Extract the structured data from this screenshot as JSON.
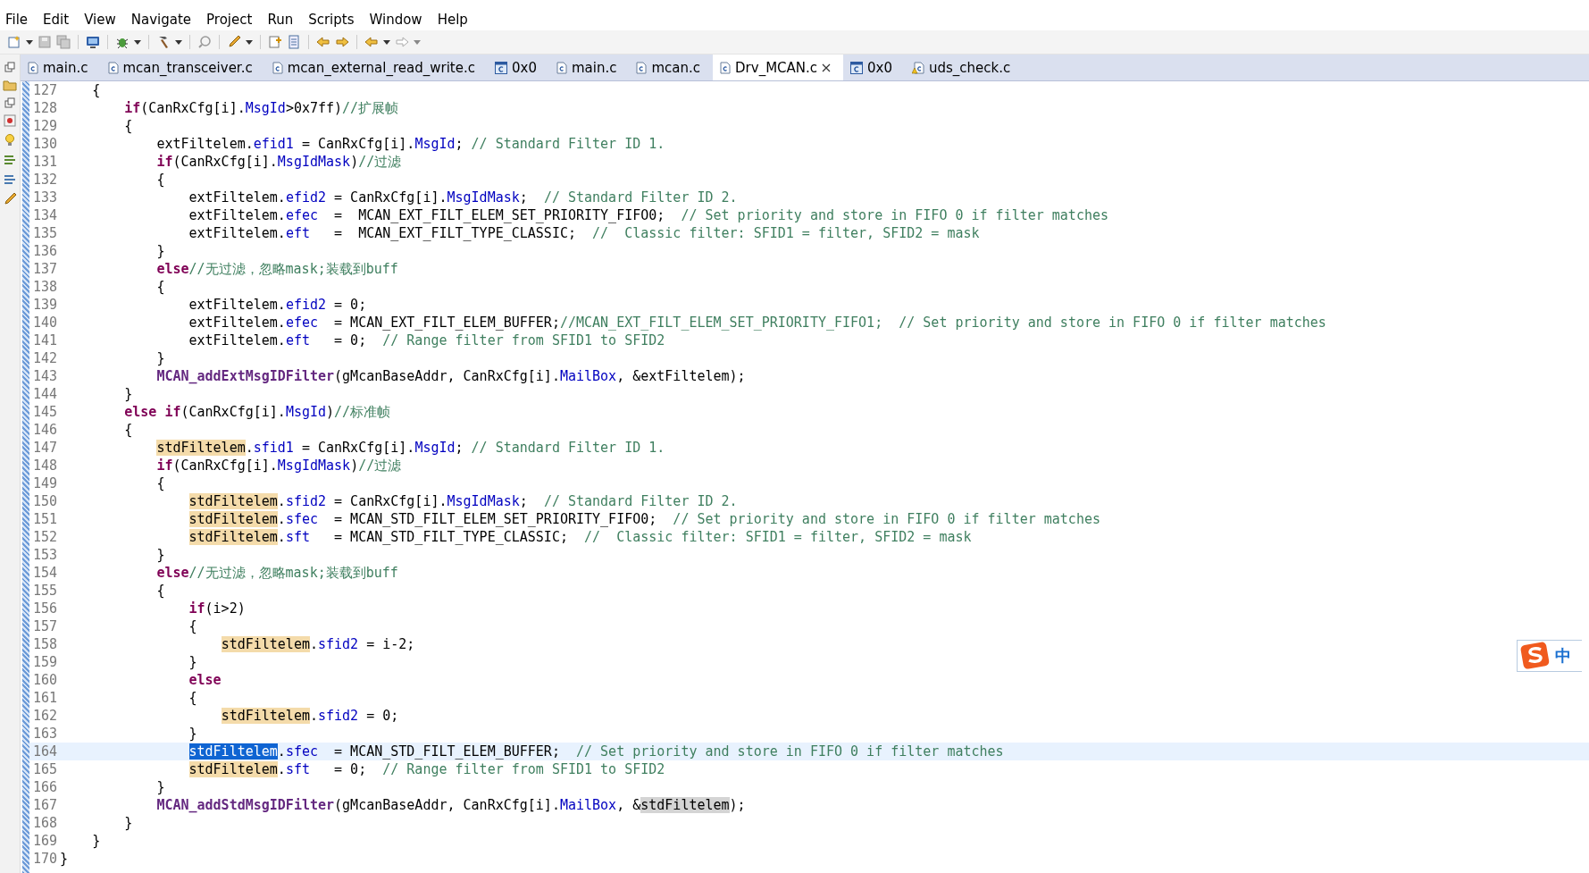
{
  "menu": [
    "File",
    "Edit",
    "View",
    "Navigate",
    "Project",
    "Run",
    "Scripts",
    "Window",
    "Help"
  ],
  "tabs": [
    {
      "label": "main.c",
      "kind": "source",
      "selected": false
    },
    {
      "label": "mcan_transceiver.c",
      "kind": "source",
      "selected": false
    },
    {
      "label": "mcan_external_read_write.c",
      "kind": "source",
      "selected": false
    },
    {
      "label": "0x0",
      "kind": "disassembly",
      "selected": false
    },
    {
      "label": "main.c",
      "kind": "source",
      "selected": false
    },
    {
      "label": "mcan.c",
      "kind": "source",
      "selected": false
    },
    {
      "label": "Drv_MCAN.c",
      "kind": "source",
      "selected": true
    },
    {
      "label": "0x0",
      "kind": "disassembly",
      "selected": false
    },
    {
      "label": "uds_check.c",
      "kind": "source-warning",
      "selected": false
    }
  ],
  "lines": [
    {
      "number": "127",
      "current": false,
      "tokens": [
        {
          "kind": "plain",
          "text": "    {"
        }
      ]
    },
    {
      "number": "128",
      "current": false,
      "tokens": [
        {
          "kind": "keyword",
          "text": "        if"
        },
        {
          "kind": "plain",
          "text": "(CanRxCfg[i]."
        },
        {
          "kind": "field",
          "text": "MsgId"
        },
        {
          "kind": "plain",
          "text": ">0x7ff)"
        },
        {
          "kind": "comment",
          "text": "//扩展帧"
        }
      ]
    },
    {
      "number": "129",
      "current": false,
      "tokens": [
        {
          "kind": "plain",
          "text": "        {"
        }
      ]
    },
    {
      "number": "130",
      "current": false,
      "tokens": [
        {
          "kind": "plain",
          "text": "            extFiltelem."
        },
        {
          "kind": "field",
          "text": "efid1"
        },
        {
          "kind": "plain",
          "text": " = CanRxCfg[i]."
        },
        {
          "kind": "field",
          "text": "MsgId"
        },
        {
          "kind": "plain",
          "text": "; "
        },
        {
          "kind": "comment",
          "text": "// Standard Filter ID 1."
        }
      ]
    },
    {
      "number": "131",
      "current": false,
      "tokens": [
        {
          "kind": "keyword",
          "text": "            if"
        },
        {
          "kind": "plain",
          "text": "(CanRxCfg[i]."
        },
        {
          "kind": "field",
          "text": "MsgIdMask"
        },
        {
          "kind": "plain",
          "text": ")"
        },
        {
          "kind": "comment",
          "text": "//过滤"
        }
      ]
    },
    {
      "number": "132",
      "current": false,
      "tokens": [
        {
          "kind": "plain",
          "text": "            {"
        }
      ]
    },
    {
      "number": "133",
      "current": false,
      "tokens": [
        {
          "kind": "plain",
          "text": "                extFiltelem."
        },
        {
          "kind": "field",
          "text": "efid2"
        },
        {
          "kind": "plain",
          "text": " = CanRxCfg[i]."
        },
        {
          "kind": "field",
          "text": "MsgIdMask"
        },
        {
          "kind": "plain",
          "text": ";  "
        },
        {
          "kind": "comment",
          "text": "// Standard Filter ID 2."
        }
      ]
    },
    {
      "number": "134",
      "current": false,
      "tokens": [
        {
          "kind": "plain",
          "text": "                extFiltelem."
        },
        {
          "kind": "field",
          "text": "efec"
        },
        {
          "kind": "plain",
          "text": "  =  MCAN_EXT_FILT_ELEM_SET_PRIORITY_FIFO0;  "
        },
        {
          "kind": "comment",
          "text": "// Set priority and store in FIFO 0 if filter matches"
        }
      ]
    },
    {
      "number": "135",
      "current": false,
      "tokens": [
        {
          "kind": "plain",
          "text": "                extFiltelem."
        },
        {
          "kind": "field",
          "text": "eft"
        },
        {
          "kind": "plain",
          "text": "   =  MCAN_EXT_FILT_TYPE_CLASSIC;  "
        },
        {
          "kind": "comment",
          "text": "//  Classic filter: SFID1 = filter, SFID2 = mask"
        }
      ]
    },
    {
      "number": "136",
      "current": false,
      "tokens": [
        {
          "kind": "plain",
          "text": "            }"
        }
      ]
    },
    {
      "number": "137",
      "current": false,
      "tokens": [
        {
          "kind": "keyword",
          "text": "            else"
        },
        {
          "kind": "comment",
          "text": "//无过滤，忽略mask;装载到buff"
        }
      ]
    },
    {
      "number": "138",
      "current": false,
      "tokens": [
        {
          "kind": "plain",
          "text": "            {"
        }
      ]
    },
    {
      "number": "139",
      "current": false,
      "tokens": [
        {
          "kind": "plain",
          "text": "                extFiltelem."
        },
        {
          "kind": "field",
          "text": "efid2"
        },
        {
          "kind": "plain",
          "text": " = 0;"
        }
      ]
    },
    {
      "number": "140",
      "current": false,
      "tokens": [
        {
          "kind": "plain",
          "text": "                extFiltelem."
        },
        {
          "kind": "field",
          "text": "efec"
        },
        {
          "kind": "plain",
          "text": "  = MCAN_EXT_FILT_ELEM_BUFFER;"
        },
        {
          "kind": "comment",
          "text": "//MCAN_EXT_FILT_ELEM_SET_PRIORITY_FIFO1;  // Set priority and store in FIFO 0 if filter matches"
        }
      ]
    },
    {
      "number": "141",
      "current": false,
      "tokens": [
        {
          "kind": "plain",
          "text": "                extFiltelem."
        },
        {
          "kind": "field",
          "text": "eft"
        },
        {
          "kind": "plain",
          "text": "   = 0;  "
        },
        {
          "kind": "comment",
          "text": "// Range filter from SFID1 to SFID2"
        }
      ]
    },
    {
      "number": "142",
      "current": false,
      "tokens": [
        {
          "kind": "plain",
          "text": "            }"
        }
      ]
    },
    {
      "number": "143",
      "current": false,
      "tokens": [
        {
          "kind": "function",
          "text": "            MCAN_addExtMsgIDFilter"
        },
        {
          "kind": "plain",
          "text": "(gMcanBaseAddr, CanRxCfg[i]."
        },
        {
          "kind": "field",
          "text": "MailBox"
        },
        {
          "kind": "plain",
          "text": ", &extFiltelem);"
        }
      ]
    },
    {
      "number": "144",
      "current": false,
      "tokens": [
        {
          "kind": "plain",
          "text": "        }"
        }
      ]
    },
    {
      "number": "145",
      "current": false,
      "tokens": [
        {
          "kind": "keyword",
          "text": "        else if"
        },
        {
          "kind": "plain",
          "text": "(CanRxCfg[i]."
        },
        {
          "kind": "field",
          "text": "MsgId"
        },
        {
          "kind": "plain",
          "text": ")"
        },
        {
          "kind": "comment",
          "text": "//标准帧"
        }
      ]
    },
    {
      "number": "146",
      "current": false,
      "tokens": [
        {
          "kind": "plain",
          "text": "        {"
        }
      ]
    },
    {
      "number": "147",
      "current": false,
      "tokens": [
        {
          "kind": "write-occurrence",
          "text": "            stdFiltelem"
        },
        {
          "kind": "plain",
          "text": "."
        },
        {
          "kind": "field",
          "text": "sfid1"
        },
        {
          "kind": "plain",
          "text": " = CanRxCfg[i]."
        },
        {
          "kind": "field",
          "text": "MsgId"
        },
        {
          "kind": "plain",
          "text": "; "
        },
        {
          "kind": "comment",
          "text": "// Standard Filter ID 1."
        }
      ]
    },
    {
      "number": "148",
      "current": false,
      "tokens": [
        {
          "kind": "keyword",
          "text": "            if"
        },
        {
          "kind": "plain",
          "text": "(CanRxCfg[i]."
        },
        {
          "kind": "field",
          "text": "MsgIdMask"
        },
        {
          "kind": "plain",
          "text": ")"
        },
        {
          "kind": "comment",
          "text": "//过滤"
        }
      ]
    },
    {
      "number": "149",
      "current": false,
      "tokens": [
        {
          "kind": "plain",
          "text": "            {"
        }
      ]
    },
    {
      "number": "150",
      "current": false,
      "tokens": [
        {
          "kind": "write-occurrence",
          "text": "                stdFiltelem"
        },
        {
          "kind": "plain",
          "text": "."
        },
        {
          "kind": "field",
          "text": "sfid2"
        },
        {
          "kind": "plain",
          "text": " = CanRxCfg[i]."
        },
        {
          "kind": "field",
          "text": "MsgIdMask"
        },
        {
          "kind": "plain",
          "text": ";  "
        },
        {
          "kind": "comment",
          "text": "// Standard Filter ID 2."
        }
      ]
    },
    {
      "number": "151",
      "current": false,
      "tokens": [
        {
          "kind": "write-occurrence",
          "text": "                stdFiltelem"
        },
        {
          "kind": "plain",
          "text": "."
        },
        {
          "kind": "field",
          "text": "sfec"
        },
        {
          "kind": "plain",
          "text": "  = MCAN_STD_FILT_ELEM_SET_PRIORITY_FIFO0;  "
        },
        {
          "kind": "comment",
          "text": "// Set priority and store in FIFO 0 if filter matches"
        }
      ]
    },
    {
      "number": "152",
      "current": false,
      "tokens": [
        {
          "kind": "write-occurrence",
          "text": "                stdFiltelem"
        },
        {
          "kind": "plain",
          "text": "."
        },
        {
          "kind": "field",
          "text": "sft"
        },
        {
          "kind": "plain",
          "text": "   = MCAN_STD_FILT_TYPE_CLASSIC;  "
        },
        {
          "kind": "comment",
          "text": "//  Classic filter: SFID1 = filter, SFID2 = mask"
        }
      ]
    },
    {
      "number": "153",
      "current": false,
      "tokens": [
        {
          "kind": "plain",
          "text": "            }"
        }
      ]
    },
    {
      "number": "154",
      "current": false,
      "tokens": [
        {
          "kind": "keyword",
          "text": "            else"
        },
        {
          "kind": "comment",
          "text": "//无过滤，忽略mask;装载到buff"
        }
      ]
    },
    {
      "number": "155",
      "current": false,
      "tokens": [
        {
          "kind": "plain",
          "text": "            {"
        }
      ]
    },
    {
      "number": "156",
      "current": false,
      "tokens": [
        {
          "kind": "keyword",
          "text": "                if"
        },
        {
          "kind": "plain",
          "text": "(i>2)"
        }
      ]
    },
    {
      "number": "157",
      "current": false,
      "tokens": [
        {
          "kind": "plain",
          "text": "                {"
        }
      ]
    },
    {
      "number": "158",
      "current": false,
      "tokens": [
        {
          "kind": "write-occurrence",
          "text": "                    stdFiltelem"
        },
        {
          "kind": "plain",
          "text": "."
        },
        {
          "kind": "field",
          "text": "sfid2"
        },
        {
          "kind": "plain",
          "text": " = i-2;"
        }
      ]
    },
    {
      "number": "159",
      "current": false,
      "tokens": [
        {
          "kind": "plain",
          "text": "                }"
        }
      ]
    },
    {
      "number": "160",
      "current": false,
      "tokens": [
        {
          "kind": "keyword",
          "text": "                else"
        }
      ]
    },
    {
      "number": "161",
      "current": false,
      "tokens": [
        {
          "kind": "plain",
          "text": "                {"
        }
      ]
    },
    {
      "number": "162",
      "current": false,
      "tokens": [
        {
          "kind": "write-occurrence",
          "text": "                    stdFiltelem"
        },
        {
          "kind": "plain",
          "text": "."
        },
        {
          "kind": "field",
          "text": "sfid2"
        },
        {
          "kind": "plain",
          "text": " = 0;"
        }
      ]
    },
    {
      "number": "163",
      "current": false,
      "tokens": [
        {
          "kind": "plain",
          "text": "                }"
        }
      ]
    },
    {
      "number": "164",
      "current": true,
      "tokens": [
        {
          "kind": "selection",
          "text": "                stdFiltelem"
        },
        {
          "kind": "plain",
          "text": "."
        },
        {
          "kind": "field",
          "text": "sfec"
        },
        {
          "kind": "plain",
          "text": "  = MCAN_STD_FILT_ELEM_BUFFER;  "
        },
        {
          "kind": "comment",
          "text": "// Set priority and store in FIFO 0 if filter matches"
        }
      ]
    },
    {
      "number": "165",
      "current": false,
      "tokens": [
        {
          "kind": "write-occurrence",
          "text": "                stdFiltelem"
        },
        {
          "kind": "plain",
          "text": "."
        },
        {
          "kind": "field",
          "text": "sft"
        },
        {
          "kind": "plain",
          "text": "   = 0;  "
        },
        {
          "kind": "comment",
          "text": "// Range filter from SFID1 to SFID2"
        }
      ]
    },
    {
      "number": "166",
      "current": false,
      "tokens": [
        {
          "kind": "plain",
          "text": "            }"
        }
      ]
    },
    {
      "number": "167",
      "current": false,
      "tokens": [
        {
          "kind": "function",
          "text": "            MCAN_addStdMsgIDFilter"
        },
        {
          "kind": "plain",
          "text": "(gMcanBaseAddr, CanRxCfg[i]."
        },
        {
          "kind": "field",
          "text": "MailBox"
        },
        {
          "kind": "plain",
          "text": ", &"
        },
        {
          "kind": "read-occurrence",
          "text": "stdFiltelem"
        },
        {
          "kind": "plain",
          "text": ");"
        }
      ]
    },
    {
      "number": "168",
      "current": false,
      "tokens": [
        {
          "kind": "plain",
          "text": "        }"
        }
      ]
    },
    {
      "number": "169",
      "current": false,
      "tokens": [
        {
          "kind": "plain",
          "text": "    }"
        }
      ]
    },
    {
      "number": "170",
      "current": false,
      "tokens": [
        {
          "kind": "plain",
          "text": "}"
        }
      ]
    }
  ],
  "ime": {
    "label": "中"
  }
}
